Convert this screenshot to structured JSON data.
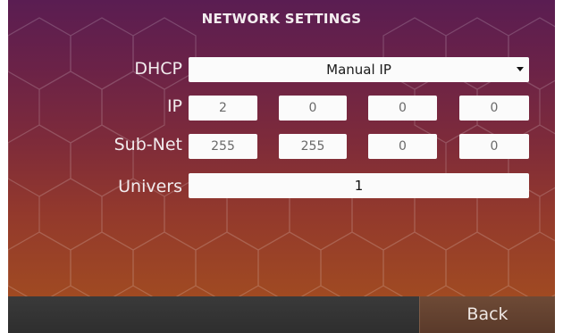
{
  "screen": {
    "title": "NETWORK SETTINGS"
  },
  "dhcp": {
    "label": "DHCP",
    "selected": "Manual IP"
  },
  "ip": {
    "label": "IP",
    "octets": [
      "2",
      "0",
      "0",
      "0"
    ]
  },
  "subnet": {
    "label": "Sub-Net",
    "octets": [
      "255",
      "255",
      "0",
      "0"
    ]
  },
  "univers": {
    "label": "Univers",
    "value": "1"
  },
  "footer": {
    "back_label": "Back"
  },
  "colors": {
    "gradient_top": "#5a1d52",
    "gradient_bottom": "#a04a22",
    "back_button": "#6e4a36",
    "bottom_bar": "#333333"
  }
}
